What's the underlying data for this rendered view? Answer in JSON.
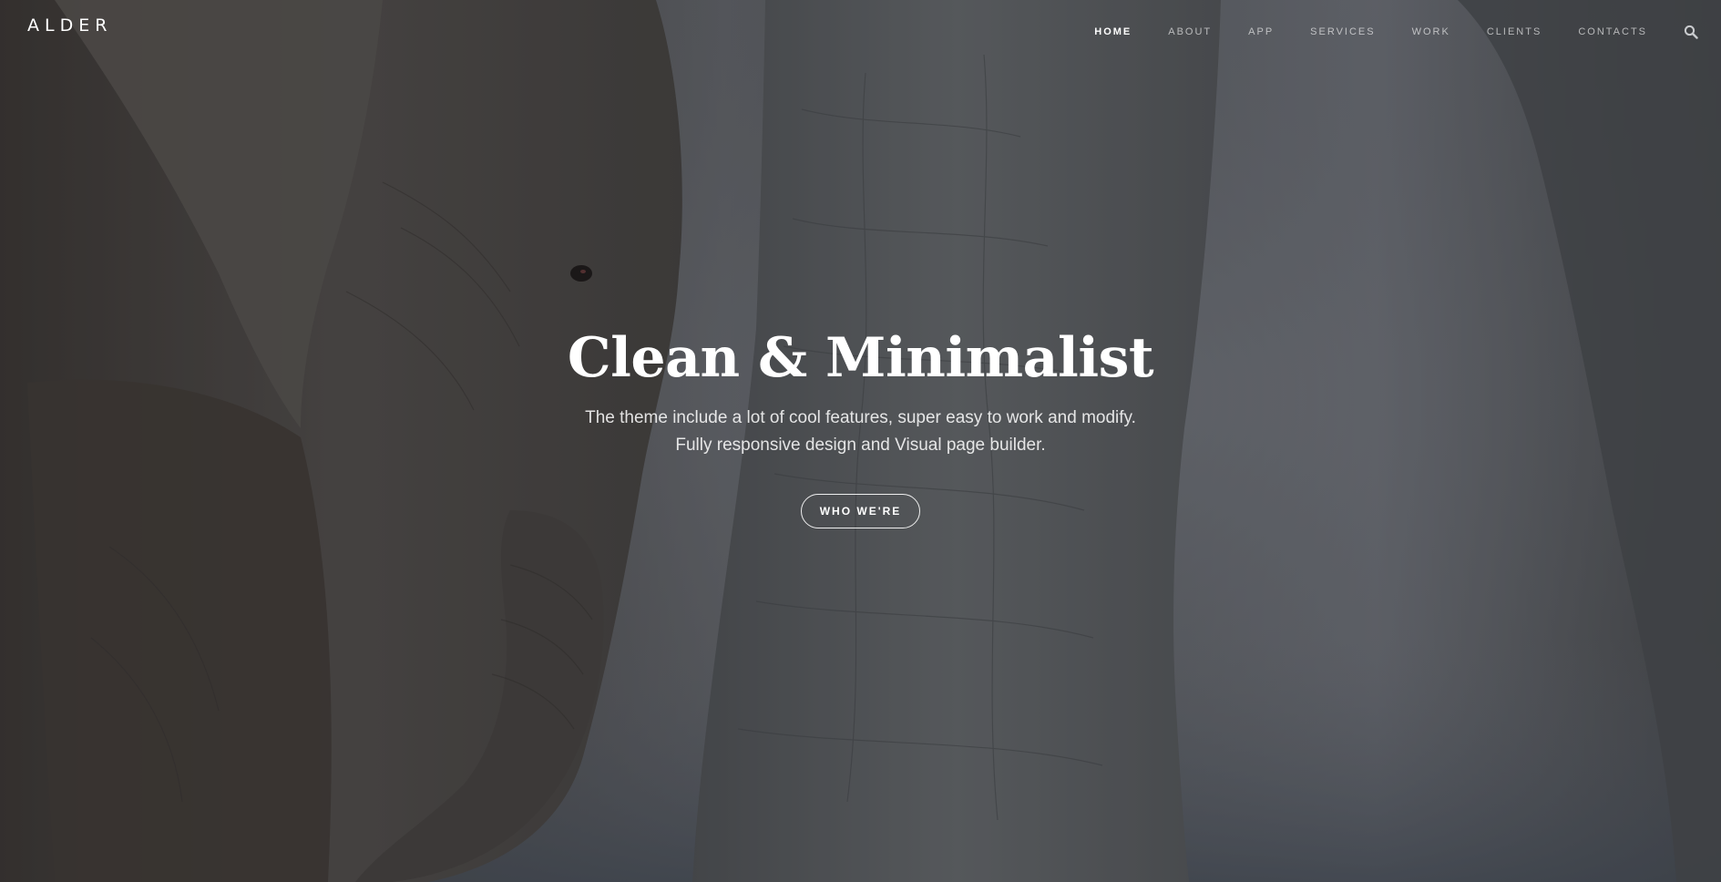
{
  "header": {
    "logo": "ALDER",
    "nav": [
      {
        "label": "HOME",
        "active": true
      },
      {
        "label": "ABOUT",
        "active": false
      },
      {
        "label": "APP",
        "active": false
      },
      {
        "label": "SERVICES",
        "active": false
      },
      {
        "label": "WORK",
        "active": false
      },
      {
        "label": "CLIENTS",
        "active": false
      },
      {
        "label": "CONTACTS",
        "active": false
      }
    ],
    "search_icon": "search-icon"
  },
  "hero": {
    "background_image": "elephants",
    "title": "Clean & Minimalist",
    "subtitle_line1": "The theme include a lot of cool features, super easy to work and modify.",
    "subtitle_line2": "Fully responsive design and Visual page builder.",
    "cta_label": "WHO WE'RE"
  },
  "colors": {
    "text": "#ffffff",
    "nav_inactive": "#b5b7ba",
    "overlay": "#14161a"
  }
}
